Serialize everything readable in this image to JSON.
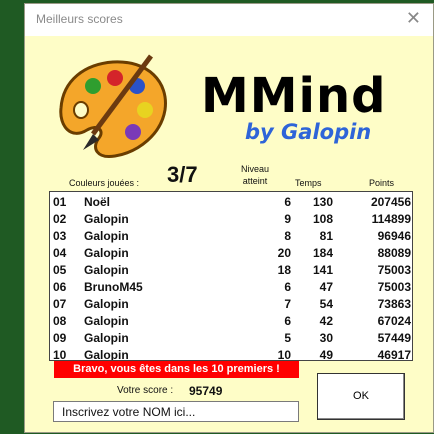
{
  "window": {
    "title": "Meilleurs scores"
  },
  "logo": {
    "name": "MMind",
    "byline": "by Galopin"
  },
  "header": {
    "colors_label": "Couleurs jouées :",
    "colors_value": "3/7",
    "level_line1": "Niveau",
    "level_line2": "atteint",
    "time_label": "Temps",
    "points_label": "Points"
  },
  "scores": [
    {
      "rank": "01",
      "name": "Noël",
      "level": "6",
      "time": "130",
      "points": "207456"
    },
    {
      "rank": "02",
      "name": "Galopin",
      "level": "9",
      "time": "108",
      "points": "114899"
    },
    {
      "rank": "03",
      "name": "Galopin",
      "level": "8",
      "time": "81",
      "points": "96946"
    },
    {
      "rank": "04",
      "name": "Galopin",
      "level": "20",
      "time": "184",
      "points": "88089"
    },
    {
      "rank": "05",
      "name": "Galopin",
      "level": "18",
      "time": "141",
      "points": "75003"
    },
    {
      "rank": "06",
      "name": "BrunoM45",
      "level": "6",
      "time": "47",
      "points": "75003"
    },
    {
      "rank": "07",
      "name": "Galopin",
      "level": "7",
      "time": "54",
      "points": "73863"
    },
    {
      "rank": "08",
      "name": "Galopin",
      "level": "6",
      "time": "42",
      "points": "67024"
    },
    {
      "rank": "09",
      "name": "Galopin",
      "level": "5",
      "time": "30",
      "points": "57449"
    },
    {
      "rank": "10",
      "name": "Galopin",
      "level": "10",
      "time": "49",
      "points": "46917"
    }
  ],
  "banner": {
    "text": "Bravo, vous êtes dans les 10 premiers !"
  },
  "score": {
    "label": "Votre score :",
    "value": "95749"
  },
  "name_input": {
    "value": "Inscrivez votre NOM ici..."
  },
  "ok_button": {
    "label": "OK"
  },
  "colors": {
    "background": "#1f5a23",
    "panel": "#fefdc7",
    "banner": "#ff0000",
    "byline": "#2e64d8"
  }
}
